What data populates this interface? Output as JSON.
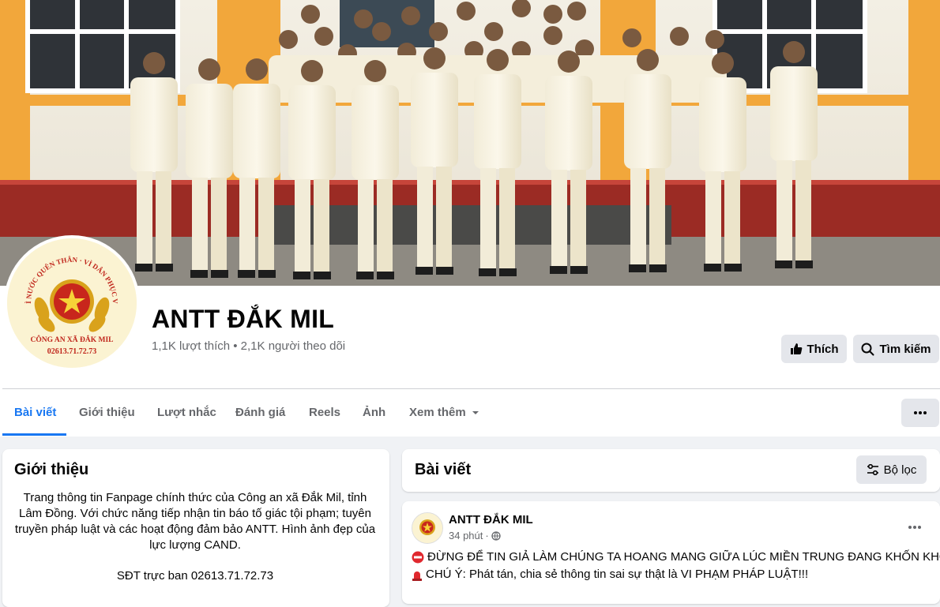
{
  "page": {
    "name": "ANTT ĐẮK MIL",
    "stats": "1,1K lượt thích • 2,1K người theo dõi",
    "avatar_text": {
      "top": "VÌ NƯỚC QUÊN THÂN · VÌ DÂN PHỤC VỤ",
      "bottom": "CÔNG AN XÃ ĐẮK MIL",
      "phone": "02613.71.72.73"
    }
  },
  "actions": {
    "like_label": "Thích",
    "search_label": "Tìm kiếm"
  },
  "tabs": [
    {
      "label": "Bài viết",
      "active": true
    },
    {
      "label": "Giới thiệu"
    },
    {
      "label": "Lượt nhắc"
    },
    {
      "label": "Đánh giá"
    },
    {
      "label": "Reels"
    },
    {
      "label": "Ảnh"
    },
    {
      "label": "Xem thêm"
    }
  ],
  "intro": {
    "title": "Giới thiệu",
    "description": "Trang thông tin Fanpage chính thức của Công an xã Đắk Mil, tỉnh Lâm Đồng. Với chức năng tiếp nhận tin báo tố giác tội phạm; tuyên truyền pháp luật và các hoạt động đảm bảo ANTT. Hình ảnh đẹp của lực lượng CAND.",
    "phone_line": "SĐT trực ban 02613.71.72.73"
  },
  "posts_section": {
    "title": "Bài viết",
    "filter_label": "Bộ lọc"
  },
  "post": {
    "author": "ANTT ĐẮK MIL",
    "time": "34 phút",
    "line1": "ĐỪNG ĐỂ TIN GIẢ LÀM CHÚNG TA HOANG MANG GIỮA LÚC MIỀN TRUNG ĐANG KHỐN KHÓ!",
    "line2": "CHÚ Ý: Phát tán, chia sẻ thông tin sai sự thật là VI PHẠM PHÁP LUẬT!!!"
  },
  "colors": {
    "accent": "#1877f2",
    "button_bg": "#e4e6eb",
    "muted_text": "#65676b",
    "page_bg": "#f0f2f5"
  }
}
